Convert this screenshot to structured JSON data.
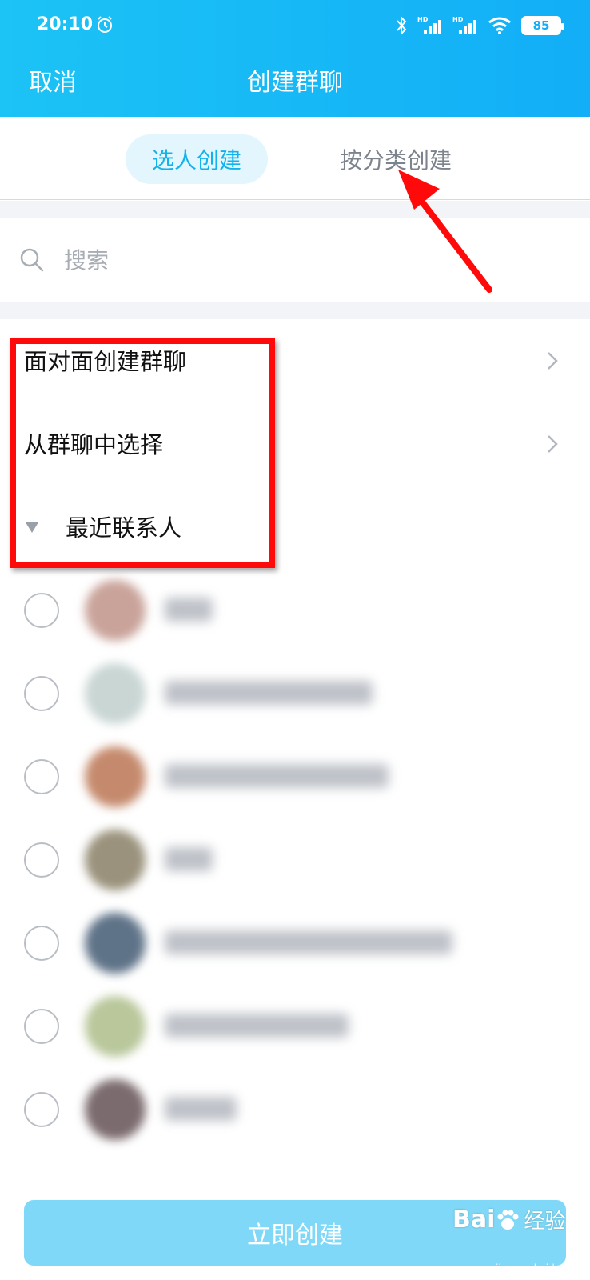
{
  "status_bar": {
    "time": "20:10",
    "battery": "85",
    "network_label": "HD"
  },
  "header": {
    "cancel_label": "取消",
    "title": "创建群聊"
  },
  "tabs": [
    {
      "label": "选人创建",
      "active": true
    },
    {
      "label": "按分类创建",
      "active": false
    }
  ],
  "search": {
    "placeholder": "搜索"
  },
  "options": [
    {
      "label": "面对面创建群聊"
    },
    {
      "label": "从群聊中选择"
    }
  ],
  "recent_section": {
    "label": "最近联系人"
  },
  "contacts": [
    {
      "avatar_color": "#c9a39a"
    },
    {
      "avatar_color": "#c9d6d4"
    },
    {
      "avatar_color": "#c58a6d"
    },
    {
      "avatar_color": "#9a927c"
    },
    {
      "avatar_color": "#5f7388"
    },
    {
      "avatar_color": "#b9c79b"
    },
    {
      "avatar_color": "#7b6b6e"
    }
  ],
  "bottom": {
    "create_label": "立即创建"
  },
  "watermark": {
    "brand": "Bai",
    "brand_tail": "经验",
    "url": "jingyan.baidu.com"
  },
  "colors": {
    "header_bg": "#12aef7",
    "accent": "#12b3ec",
    "annotation_red": "#ff0a0a",
    "button_bg": "#7fd8f7"
  }
}
